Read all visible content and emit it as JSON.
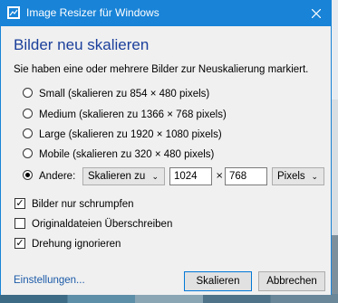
{
  "window": {
    "title": "Image Resizer für Windows"
  },
  "heading": "Bilder neu skalieren",
  "description": "Sie haben eine oder mehrere Bilder zur Neuskalierung markiert.",
  "sizes": [
    {
      "label": "Small (skalieren zu 854 × 480 pixels)",
      "selected": false
    },
    {
      "label": "Medium (skalieren zu 1366 × 768 pixels)",
      "selected": false
    },
    {
      "label": "Large (skalieren zu 1920 × 1080 pixels)",
      "selected": false
    },
    {
      "label": "Mobile (skalieren zu 320 × 480 pixels)",
      "selected": false
    },
    {
      "label": "Andere:",
      "selected": true
    }
  ],
  "custom": {
    "mode": "Skalieren zu",
    "width": "1024",
    "separator": "×",
    "height": "768",
    "unit": "Pixels"
  },
  "options": [
    {
      "label": "Bilder nur schrumpfen",
      "checked": true
    },
    {
      "label": "Originaldateien Überschreiben",
      "checked": false
    },
    {
      "label": "Drehung ignorieren",
      "checked": true
    }
  ],
  "footer": {
    "settings_link": "Einstellungen...",
    "resize_button": "Skalieren",
    "cancel_button": "Abbrechen"
  },
  "colors": {
    "titlebar": "#1883d7",
    "heading": "#1b3f9b",
    "link": "#1b5aa8"
  },
  "icons": {
    "app": "image-resizer-icon",
    "close": "close-icon",
    "dropdown": "chevron-down-icon"
  }
}
